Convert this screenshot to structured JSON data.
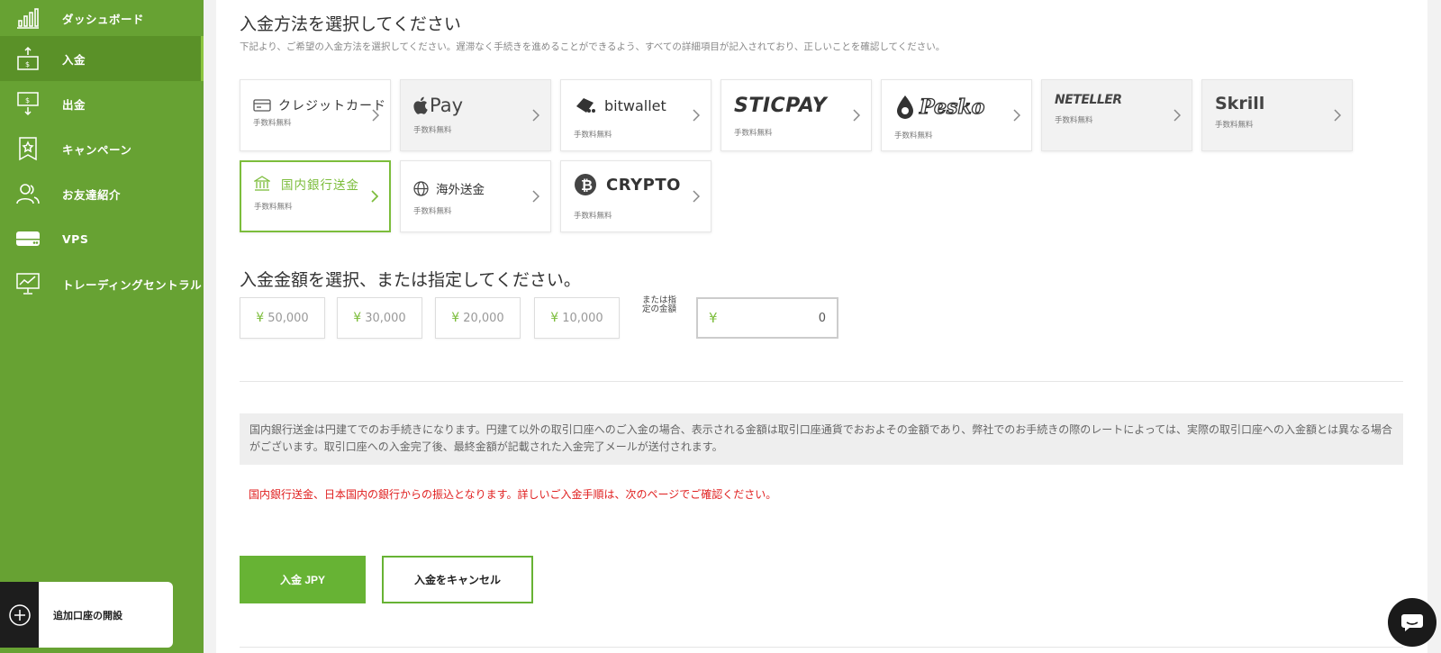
{
  "sidebar": {
    "items": [
      {
        "label": "ダッシュボード",
        "icon": "bar-chart-icon"
      },
      {
        "label": "入金",
        "icon": "deposit-icon"
      },
      {
        "label": "出金",
        "icon": "withdraw-icon"
      },
      {
        "label": "キャンペーン",
        "icon": "star-badge-icon"
      },
      {
        "label": "お友達紹介",
        "icon": "users-icon"
      },
      {
        "label": "VPS",
        "icon": "server-icon"
      },
      {
        "label": "トレーディングセントラル",
        "icon": "monitor-chart-icon"
      }
    ],
    "add_account": "追加口座の開設"
  },
  "main": {
    "title": "入金方法を選択してください",
    "subtitle": "下記より、ご希望の入金方法を選択してください。遅滞なく手続きを進めることができるよう、すべての詳細項目が記入されており、正しいことを確認してください。",
    "methods": [
      {
        "label": "クレジットカード",
        "fee": "手数料無料"
      },
      {
        "label": "Pay",
        "fee": "手数料無料"
      },
      {
        "label": "bitwallet",
        "fee": "手数料無料"
      },
      {
        "label": "STICPAY",
        "fee": "手数料無料"
      },
      {
        "label": "Pesko",
        "fee": "手数料無料"
      },
      {
        "label": "NETELLER",
        "fee": "手数料無料"
      },
      {
        "label": "Skrill",
        "fee": "手数料無料"
      },
      {
        "label": "国内銀行送金",
        "fee": "手数料無料"
      },
      {
        "label": "海外送金",
        "fee": "手数料無料"
      },
      {
        "label": "CRYPTO",
        "fee": "手数料無料"
      }
    ],
    "amount_title": "入金金額を選択、または指定してください。",
    "currency_symbol": "¥",
    "amounts": [
      "50,000",
      "30,000",
      "20,000",
      "10,000"
    ],
    "or_label": "または指定の金額",
    "custom_value": "0",
    "notice": "国内銀行送金は円建てでのお手続きになります。円建て以外の取引口座へのご入金の場合、表示される金額は取引口座通貨でおおよその金額であり、弊社でのお手続きの際のレートによっては、実際の取引口座への入金額とは異なる場合がございます。取引口座への入金完了後、最終金額が記載された入金完了メールが送付されます。",
    "warning": "国内銀行送金、日本国内の銀行からの振込となります。詳しいご入金手順は、次のページでご確認ください。",
    "primary_button": "入金 JPY",
    "secondary_button": "入金をキャンセル"
  },
  "colors": {
    "brand_green": "#67a233",
    "accent_green": "#7cbd3b",
    "warning_red": "#e02020"
  }
}
